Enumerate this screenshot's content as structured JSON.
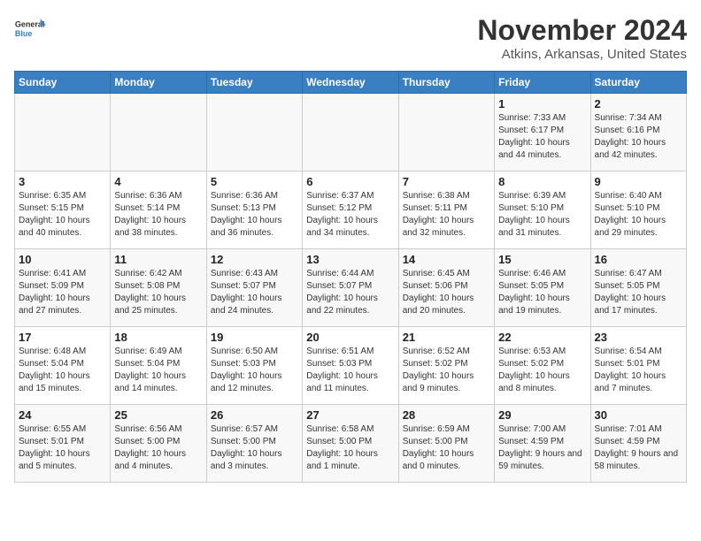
{
  "logo": {
    "text_general": "General",
    "text_blue": "Blue"
  },
  "header": {
    "month": "November 2024",
    "location": "Atkins, Arkansas, United States"
  },
  "weekdays": [
    "Sunday",
    "Monday",
    "Tuesday",
    "Wednesday",
    "Thursday",
    "Friday",
    "Saturday"
  ],
  "weeks": [
    [
      {
        "day": "",
        "sunrise": "",
        "sunset": "",
        "daylight": ""
      },
      {
        "day": "",
        "sunrise": "",
        "sunset": "",
        "daylight": ""
      },
      {
        "day": "",
        "sunrise": "",
        "sunset": "",
        "daylight": ""
      },
      {
        "day": "",
        "sunrise": "",
        "sunset": "",
        "daylight": ""
      },
      {
        "day": "",
        "sunrise": "",
        "sunset": "",
        "daylight": ""
      },
      {
        "day": "1",
        "sunrise": "Sunrise: 7:33 AM",
        "sunset": "Sunset: 6:17 PM",
        "daylight": "Daylight: 10 hours and 44 minutes."
      },
      {
        "day": "2",
        "sunrise": "Sunrise: 7:34 AM",
        "sunset": "Sunset: 6:16 PM",
        "daylight": "Daylight: 10 hours and 42 minutes."
      }
    ],
    [
      {
        "day": "3",
        "sunrise": "Sunrise: 6:35 AM",
        "sunset": "Sunset: 5:15 PM",
        "daylight": "Daylight: 10 hours and 40 minutes."
      },
      {
        "day": "4",
        "sunrise": "Sunrise: 6:36 AM",
        "sunset": "Sunset: 5:14 PM",
        "daylight": "Daylight: 10 hours and 38 minutes."
      },
      {
        "day": "5",
        "sunrise": "Sunrise: 6:36 AM",
        "sunset": "Sunset: 5:13 PM",
        "daylight": "Daylight: 10 hours and 36 minutes."
      },
      {
        "day": "6",
        "sunrise": "Sunrise: 6:37 AM",
        "sunset": "Sunset: 5:12 PM",
        "daylight": "Daylight: 10 hours and 34 minutes."
      },
      {
        "day": "7",
        "sunrise": "Sunrise: 6:38 AM",
        "sunset": "Sunset: 5:11 PM",
        "daylight": "Daylight: 10 hours and 32 minutes."
      },
      {
        "day": "8",
        "sunrise": "Sunrise: 6:39 AM",
        "sunset": "Sunset: 5:10 PM",
        "daylight": "Daylight: 10 hours and 31 minutes."
      },
      {
        "day": "9",
        "sunrise": "Sunrise: 6:40 AM",
        "sunset": "Sunset: 5:10 PM",
        "daylight": "Daylight: 10 hours and 29 minutes."
      }
    ],
    [
      {
        "day": "10",
        "sunrise": "Sunrise: 6:41 AM",
        "sunset": "Sunset: 5:09 PM",
        "daylight": "Daylight: 10 hours and 27 minutes."
      },
      {
        "day": "11",
        "sunrise": "Sunrise: 6:42 AM",
        "sunset": "Sunset: 5:08 PM",
        "daylight": "Daylight: 10 hours and 25 minutes."
      },
      {
        "day": "12",
        "sunrise": "Sunrise: 6:43 AM",
        "sunset": "Sunset: 5:07 PM",
        "daylight": "Daylight: 10 hours and 24 minutes."
      },
      {
        "day": "13",
        "sunrise": "Sunrise: 6:44 AM",
        "sunset": "Sunset: 5:07 PM",
        "daylight": "Daylight: 10 hours and 22 minutes."
      },
      {
        "day": "14",
        "sunrise": "Sunrise: 6:45 AM",
        "sunset": "Sunset: 5:06 PM",
        "daylight": "Daylight: 10 hours and 20 minutes."
      },
      {
        "day": "15",
        "sunrise": "Sunrise: 6:46 AM",
        "sunset": "Sunset: 5:05 PM",
        "daylight": "Daylight: 10 hours and 19 minutes."
      },
      {
        "day": "16",
        "sunrise": "Sunrise: 6:47 AM",
        "sunset": "Sunset: 5:05 PM",
        "daylight": "Daylight: 10 hours and 17 minutes."
      }
    ],
    [
      {
        "day": "17",
        "sunrise": "Sunrise: 6:48 AM",
        "sunset": "Sunset: 5:04 PM",
        "daylight": "Daylight: 10 hours and 15 minutes."
      },
      {
        "day": "18",
        "sunrise": "Sunrise: 6:49 AM",
        "sunset": "Sunset: 5:04 PM",
        "daylight": "Daylight: 10 hours and 14 minutes."
      },
      {
        "day": "19",
        "sunrise": "Sunrise: 6:50 AM",
        "sunset": "Sunset: 5:03 PM",
        "daylight": "Daylight: 10 hours and 12 minutes."
      },
      {
        "day": "20",
        "sunrise": "Sunrise: 6:51 AM",
        "sunset": "Sunset: 5:03 PM",
        "daylight": "Daylight: 10 hours and 11 minutes."
      },
      {
        "day": "21",
        "sunrise": "Sunrise: 6:52 AM",
        "sunset": "Sunset: 5:02 PM",
        "daylight": "Daylight: 10 hours and 9 minutes."
      },
      {
        "day": "22",
        "sunrise": "Sunrise: 6:53 AM",
        "sunset": "Sunset: 5:02 PM",
        "daylight": "Daylight: 10 hours and 8 minutes."
      },
      {
        "day": "23",
        "sunrise": "Sunrise: 6:54 AM",
        "sunset": "Sunset: 5:01 PM",
        "daylight": "Daylight: 10 hours and 7 minutes."
      }
    ],
    [
      {
        "day": "24",
        "sunrise": "Sunrise: 6:55 AM",
        "sunset": "Sunset: 5:01 PM",
        "daylight": "Daylight: 10 hours and 5 minutes."
      },
      {
        "day": "25",
        "sunrise": "Sunrise: 6:56 AM",
        "sunset": "Sunset: 5:00 PM",
        "daylight": "Daylight: 10 hours and 4 minutes."
      },
      {
        "day": "26",
        "sunrise": "Sunrise: 6:57 AM",
        "sunset": "Sunset: 5:00 PM",
        "daylight": "Daylight: 10 hours and 3 minutes."
      },
      {
        "day": "27",
        "sunrise": "Sunrise: 6:58 AM",
        "sunset": "Sunset: 5:00 PM",
        "daylight": "Daylight: 10 hours and 1 minute."
      },
      {
        "day": "28",
        "sunrise": "Sunrise: 6:59 AM",
        "sunset": "Sunset: 5:00 PM",
        "daylight": "Daylight: 10 hours and 0 minutes."
      },
      {
        "day": "29",
        "sunrise": "Sunrise: 7:00 AM",
        "sunset": "Sunset: 4:59 PM",
        "daylight": "Daylight: 9 hours and 59 minutes."
      },
      {
        "day": "30",
        "sunrise": "Sunrise: 7:01 AM",
        "sunset": "Sunset: 4:59 PM",
        "daylight": "Daylight: 9 hours and 58 minutes."
      }
    ]
  ]
}
